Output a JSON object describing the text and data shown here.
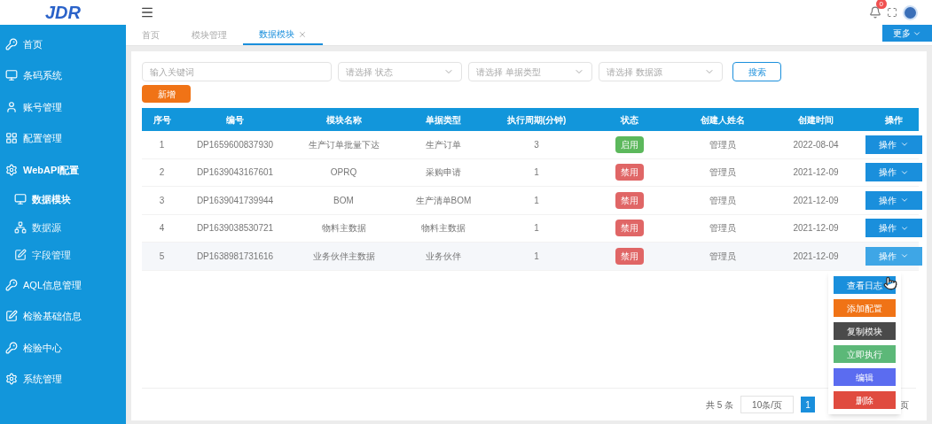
{
  "logo": {
    "text": "JDR"
  },
  "sidebar": {
    "items": [
      {
        "label": "首页",
        "expanded": false,
        "selected": false
      },
      {
        "label": "条码系统",
        "expanded": false,
        "selected": false
      },
      {
        "label": "账号管理",
        "expanded": false,
        "selected": false
      },
      {
        "label": "配置管理",
        "expanded": false,
        "selected": false
      },
      {
        "label": "WebAPI配置",
        "expanded": true,
        "selected": false,
        "children": [
          {
            "label": "数据模块",
            "selected": true
          },
          {
            "label": "数据源",
            "selected": false
          },
          {
            "label": "字段管理",
            "selected": false
          }
        ]
      },
      {
        "label": "AQL信息管理",
        "expanded": false,
        "selected": false
      },
      {
        "label": "检验基础信息",
        "expanded": false,
        "selected": false
      },
      {
        "label": "检验中心",
        "expanded": false,
        "selected": false
      },
      {
        "label": "系统管理",
        "expanded": false,
        "selected": false
      }
    ]
  },
  "header": {
    "notification_count": "0",
    "more_button": "更多"
  },
  "tabs": [
    {
      "label": "首页",
      "selected": false
    },
    {
      "label": "模块管理",
      "selected": false
    },
    {
      "label": "数据模块",
      "selected": true
    }
  ],
  "filters": {
    "keyword": {
      "placeholder": "输入关键词"
    },
    "selects": [
      {
        "placeholder": "请选择 状态"
      },
      {
        "placeholder": "请选择 单据类型"
      },
      {
        "placeholder": "请选择 数据源"
      }
    ],
    "search_button": "搜索",
    "add_button": "新增"
  },
  "table": {
    "columns": [
      "序号",
      "编号",
      "模块名称",
      "单据类型",
      "执行周期(分钟)",
      "状态",
      "创建人姓名",
      "创建时间",
      "操作"
    ],
    "rows": [
      {
        "index": "1",
        "code": "DP1659600837930",
        "name": "生产订单批量下达",
        "doc_type": "生产订单",
        "period": "3",
        "status": "启用",
        "enabled": true,
        "creator": "管理员",
        "created": "2022-08-04",
        "action": "操作",
        "hovered": false
      },
      {
        "index": "2",
        "code": "DP1639043167601",
        "name": "OPRQ",
        "doc_type": "采购申请",
        "period": "1",
        "status": "禁用",
        "enabled": false,
        "creator": "管理员",
        "created": "2021-12-09",
        "action": "操作",
        "hovered": false
      },
      {
        "index": "3",
        "code": "DP1639041739944",
        "name": "BOM",
        "doc_type": "生产清单BOM",
        "period": "1",
        "status": "禁用",
        "enabled": false,
        "creator": "管理员",
        "created": "2021-12-09",
        "action": "操作",
        "hovered": false
      },
      {
        "index": "4",
        "code": "DP1639038530721",
        "name": "物料主数据",
        "doc_type": "物料主数据",
        "period": "1",
        "status": "禁用",
        "enabled": false,
        "creator": "管理员",
        "created": "2021-12-09",
        "action": "操作",
        "hovered": false
      },
      {
        "index": "5",
        "code": "DP1638981731616",
        "name": "业务伙伴主数据",
        "doc_type": "业务伙伴",
        "period": "1",
        "status": "禁用",
        "enabled": false,
        "creator": "管理员",
        "created": "2021-12-09",
        "action": "操作",
        "hovered": true
      }
    ]
  },
  "action_menu": {
    "items": [
      {
        "label": "查看日志",
        "color": "#1a8fdc"
      },
      {
        "label": "添加配置",
        "color": "#f07316"
      },
      {
        "label": "复制模块",
        "color": "#4a4a4a"
      },
      {
        "label": "立即执行",
        "color": "#5cb878"
      },
      {
        "label": "编辑",
        "color": "#5b6cf0"
      },
      {
        "label": "删除",
        "color": "#e04b3f"
      }
    ]
  },
  "pagination": {
    "total": "共 5 条",
    "page_size": "10条/页",
    "pages": [
      {
        "label": "1",
        "selected": true
      }
    ],
    "suffix": "页"
  }
}
